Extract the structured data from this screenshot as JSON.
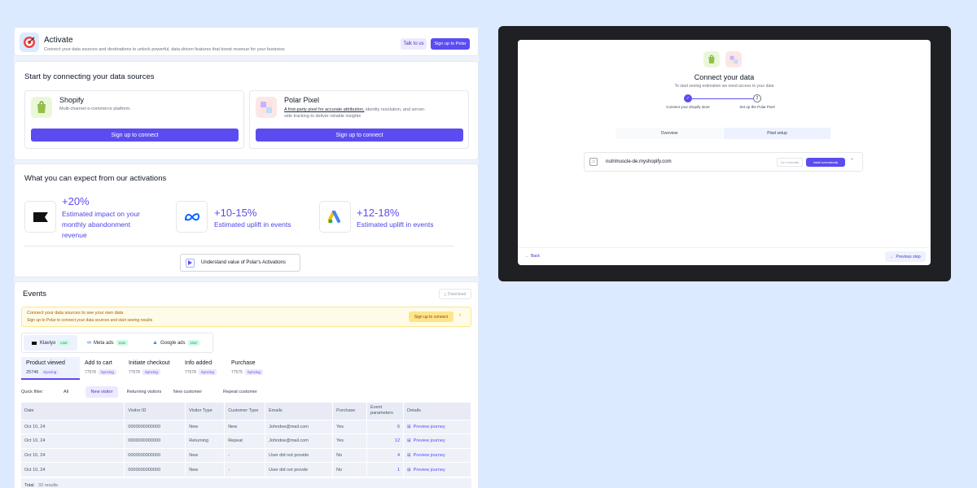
{
  "header": {
    "title": "Activate",
    "subtitle": "Connect your data sources and destinations to unlock powerful, data-driven features that boost revenue for your business",
    "talk_label": "Talk to us",
    "signup_label": "Sign up to Polar"
  },
  "sources": {
    "heading": "Start by connecting your data sources",
    "shopify": {
      "name": "Shopify",
      "desc": "Multi-channel e-commerce platform.",
      "cta": "Sign up to connect"
    },
    "pixel": {
      "name": "Polar Pixel",
      "desc_link": "A first-party pixel for accurate attribution,",
      "desc_rest": " identity resolution, and server-",
      "desc_line2": "side tracking to deliver reliable insights",
      "cta": "Sign up to connect"
    }
  },
  "expect": {
    "heading": "What you can expect from our activations",
    "items": [
      {
        "value": "+20%",
        "line1": "Estimated impact on your",
        "line2": "monthly abandonment",
        "line3": "revenue"
      },
      {
        "value": "+10-15%",
        "line1": "Estimated uplift in events"
      },
      {
        "value": "+12-18%",
        "line1": "Estimated uplift in events"
      }
    ],
    "cta": "Understand value of Polar's Activations"
  },
  "events": {
    "heading": "Events",
    "download_label": "Download",
    "banner": {
      "title": "Connect your data sources to see your own data",
      "text": "Sign up to Polar to connect your data sources and start seeing results",
      "cta": "Sign up to connect"
    },
    "tabs": [
      {
        "label": "Klaviyo",
        "badge": "Live"
      },
      {
        "label": "Meta ads",
        "badge": "Live"
      },
      {
        "label": "Google ads",
        "badge": "Live"
      }
    ],
    "event_types": [
      {
        "label": "Product viewed",
        "count": "25746",
        "badge": "Syncing"
      },
      {
        "label": "Add to cart",
        "count": "77578",
        "badge": "Syncing"
      },
      {
        "label": "Initiate checkout",
        "count": "77578",
        "badge": "Syncing"
      },
      {
        "label": "Info added",
        "count": "77578",
        "badge": "Syncing"
      },
      {
        "label": "Purchase",
        "count": "77575",
        "badge": "Syncing"
      }
    ],
    "quick_filter_label": "Quick filter:",
    "filters": [
      "All",
      "New visitor",
      "Returning visitors",
      "New customer",
      "Repeat customer"
    ],
    "columns": [
      "Date",
      "Visitor ID",
      "Visitor Type",
      "Customer Type",
      "Emails",
      "Purchase",
      "Event parameters",
      "Details"
    ],
    "rows": [
      {
        "date": "Oct 10, 24",
        "visitor_id": "0000000000000",
        "visitor_type": "New",
        "customer_type": "New",
        "email": "Johndoe@mail.com",
        "purchase": "Yes",
        "params": "6",
        "details": "Preview journey"
      },
      {
        "date": "Oct 10, 24",
        "visitor_id": "0000000000000",
        "visitor_type": "Returning",
        "customer_type": "Repeat",
        "email": "Johndoe@mail.com",
        "purchase": "Yes",
        "params": "12",
        "details": "Preview journey"
      },
      {
        "date": "Oct 10, 24",
        "visitor_id": "0000000000000",
        "visitor_type": "New",
        "customer_type": "-",
        "email": "User did not provide",
        "purchase": "No",
        "params": "4",
        "details": "Preview journey"
      },
      {
        "date": "Oct 10, 24",
        "visitor_id": "0000000000000",
        "visitor_type": "New",
        "customer_type": "-",
        "email": "User did not provde",
        "purchase": "No",
        "params": "1",
        "details": "Preview journey"
      }
    ],
    "total_label": "Total",
    "total_value": "32 results"
  },
  "modal": {
    "title": "Connect your data",
    "subtitle": "To start seeing estimation we need access to your data",
    "steps": [
      {
        "label": "Connect your shopify store",
        "marker": "✓"
      },
      {
        "label": "Set up the Polar Pixel",
        "marker": "2"
      }
    ],
    "tabs": [
      "Overview",
      "Pixel setup"
    ],
    "store_url": "nutrimuscle-de.myshopify.com",
    "manual_label": "Do it manually",
    "install_label": "Install automatically",
    "back_label": "Back",
    "previous_label": "Previous step"
  },
  "colors": {
    "accent": "#5b4cf0",
    "background": "#dbeafe",
    "frame": "#1f2023"
  }
}
